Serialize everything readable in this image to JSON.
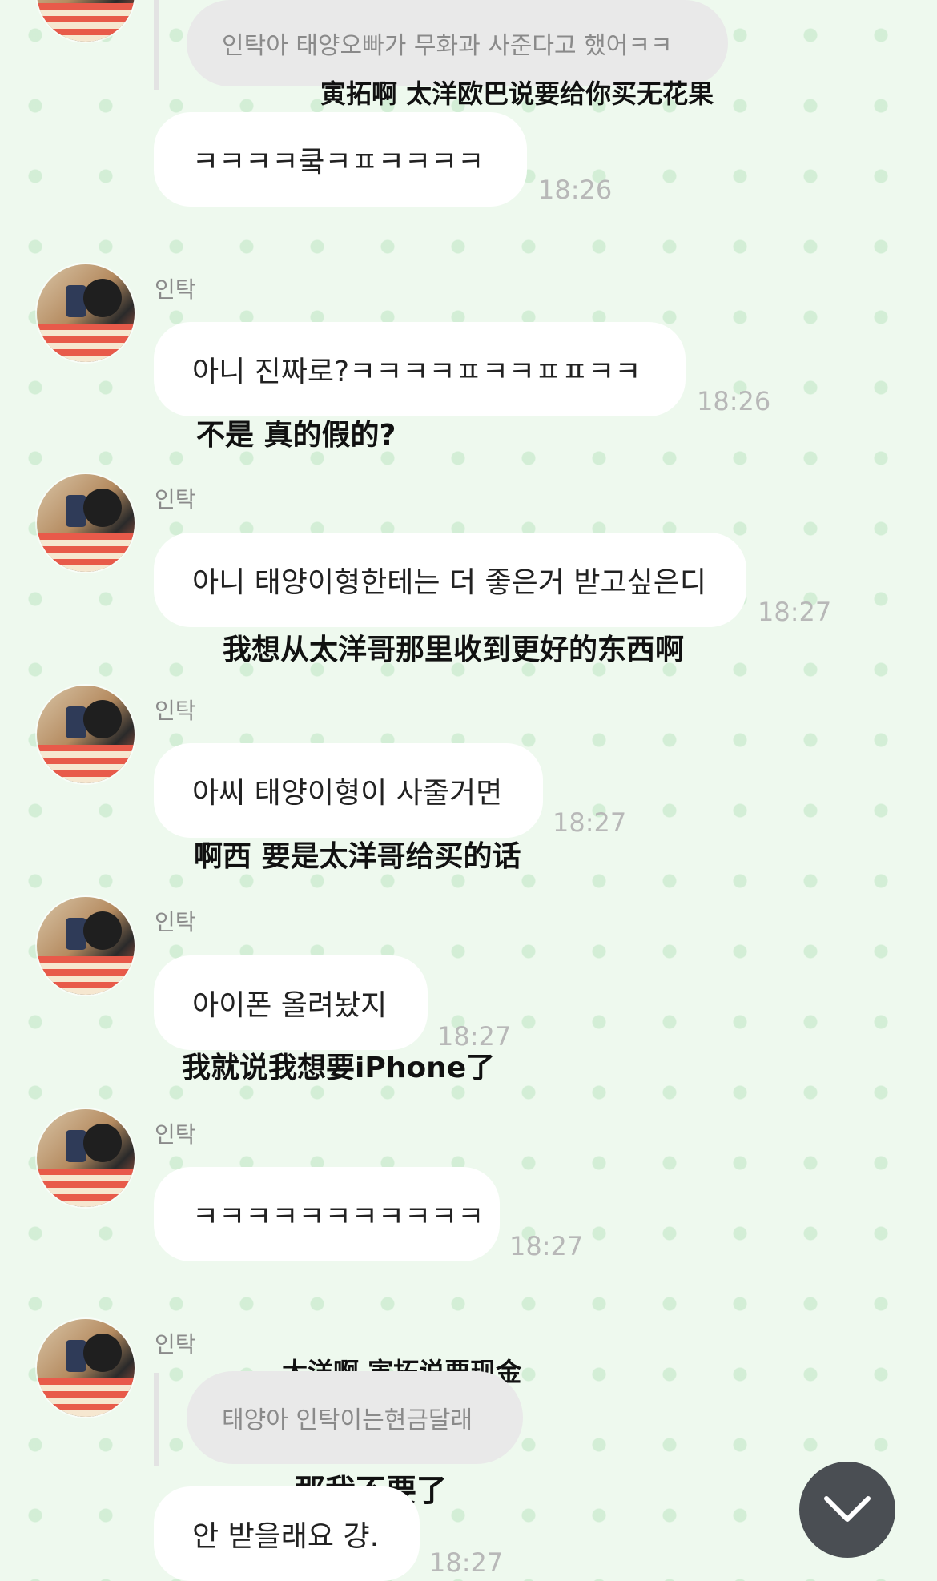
{
  "messages": [
    {
      "reply_text": "인탁아 태양오빠가 무화과 사준다고 했어ㅋㅋ",
      "caption": "寅拓啊 太洋欧巴说要给你买无花果",
      "text": "ㅋㅋㅋㅋ쿸ㅋㅍㅋㅋㅋㅋ",
      "time": "18:26"
    },
    {
      "sender": "인탁",
      "text": "아니 진짜로?ㅋㅋㅋㅋㅍㅋㅋㅍㅍㅋㅋ",
      "time": "18:26",
      "caption": "不是 真的假的?"
    },
    {
      "sender": "인탁",
      "text": "아니 태양이형한테는 더 좋은거 받고싶은디",
      "time": "18:27",
      "caption": "我想从太洋哥那里收到更好的东西啊"
    },
    {
      "sender": "인탁",
      "text": "아씨 태양이형이 사줄거면",
      "time": "18:27",
      "caption": "啊西 要是太洋哥给买的话"
    },
    {
      "sender": "인탁",
      "text": "아이폰 올려놨지",
      "time": "18:27",
      "caption": "我就说我想要iPhone了"
    },
    {
      "sender": "인탁",
      "text": "ㅋㅋㅋㅋㅋㅋㅋㅋㅋㅋㅋ",
      "time": "18:27"
    },
    {
      "sender": "인탁",
      "caption_top": "太洋啊 寅拓说要现金",
      "reply_text": "태양아 인탁이는현금달래",
      "caption": "那我不要了",
      "text": "안 받을래요 걍.",
      "time": "18:27"
    }
  ],
  "icons": {
    "avatar": "profile-photo",
    "scroll_button": "chevron-down-icon"
  },
  "colors": {
    "background": "#eef9ee",
    "bubble": "#ffffff",
    "reply_bubble": "#e9e9e9",
    "timestamp": "#b8b8b8",
    "scroll_button": "#4a4e53"
  }
}
